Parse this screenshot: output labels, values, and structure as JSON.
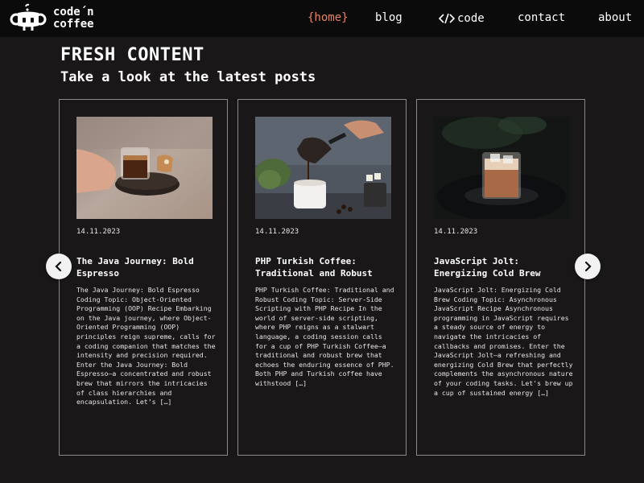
{
  "header": {
    "logo": {
      "line1": "code´n",
      "line2": "coffee"
    },
    "nav": {
      "home": "{home}",
      "blog": "blog",
      "code": "code",
      "contact": "contact",
      "about": "about"
    },
    "accent_color": "#e08466"
  },
  "section": {
    "title": "FRESH CONTENT",
    "subtitle": "Take a look at the latest posts"
  },
  "posts": [
    {
      "date": "14.11.2023",
      "title": "The Java Journey: Bold Espresso",
      "excerpt": "The Java Journey: Bold Espresso Coding Topic: Object-Oriented Programming (OOP) Recipe Embarking on the Java journey, where Object-Oriented Programming (OOP) principles reign supreme, calls for a coding companion that matches the intensity and precision required. Enter the Java Journey: Bold Espresso—a concentrated and robust brew that mirrors the intricacies of class hierarchies and encapsulation. Let’s […]",
      "image": "espresso-glass-photo"
    },
    {
      "date": "14.11.2023",
      "title": "PHP Turkish Coffee: Traditional and Robust",
      "excerpt": "PHP Turkish Coffee: Traditional and Robust Coding Topic: Server-Side Scripting with PHP Recipe In the world of server-side scripting, where PHP reigns as a stalwart language, a coding session calls for a cup of PHP Turkish Coffee—a traditional and robust brew that echoes the enduring essence of PHP. Both PHP and Turkish coffee have withstood […]",
      "image": "turkish-coffee-pour-photo"
    },
    {
      "date": "14.11.2023",
      "title": "JavaScript Jolt: Energizing Cold Brew",
      "excerpt": "JavaScript Jolt: Energizing Cold Brew Coding Topic: Asynchronous JavaScript Recipe Asynchronous programming in JavaScript requires a steady source of energy to navigate the intricacies of callbacks and promises. Enter the JavaScript Jolt—a refreshing and energizing Cold Brew that perfectly complements the asynchronous nature of your coding tasks. Let's brew up a cup of sustained energy […]",
      "image": "iced-cold-brew-photo"
    }
  ],
  "carousel": {
    "prev_icon": "chevron-left-icon",
    "next_icon": "chevron-right-icon"
  }
}
